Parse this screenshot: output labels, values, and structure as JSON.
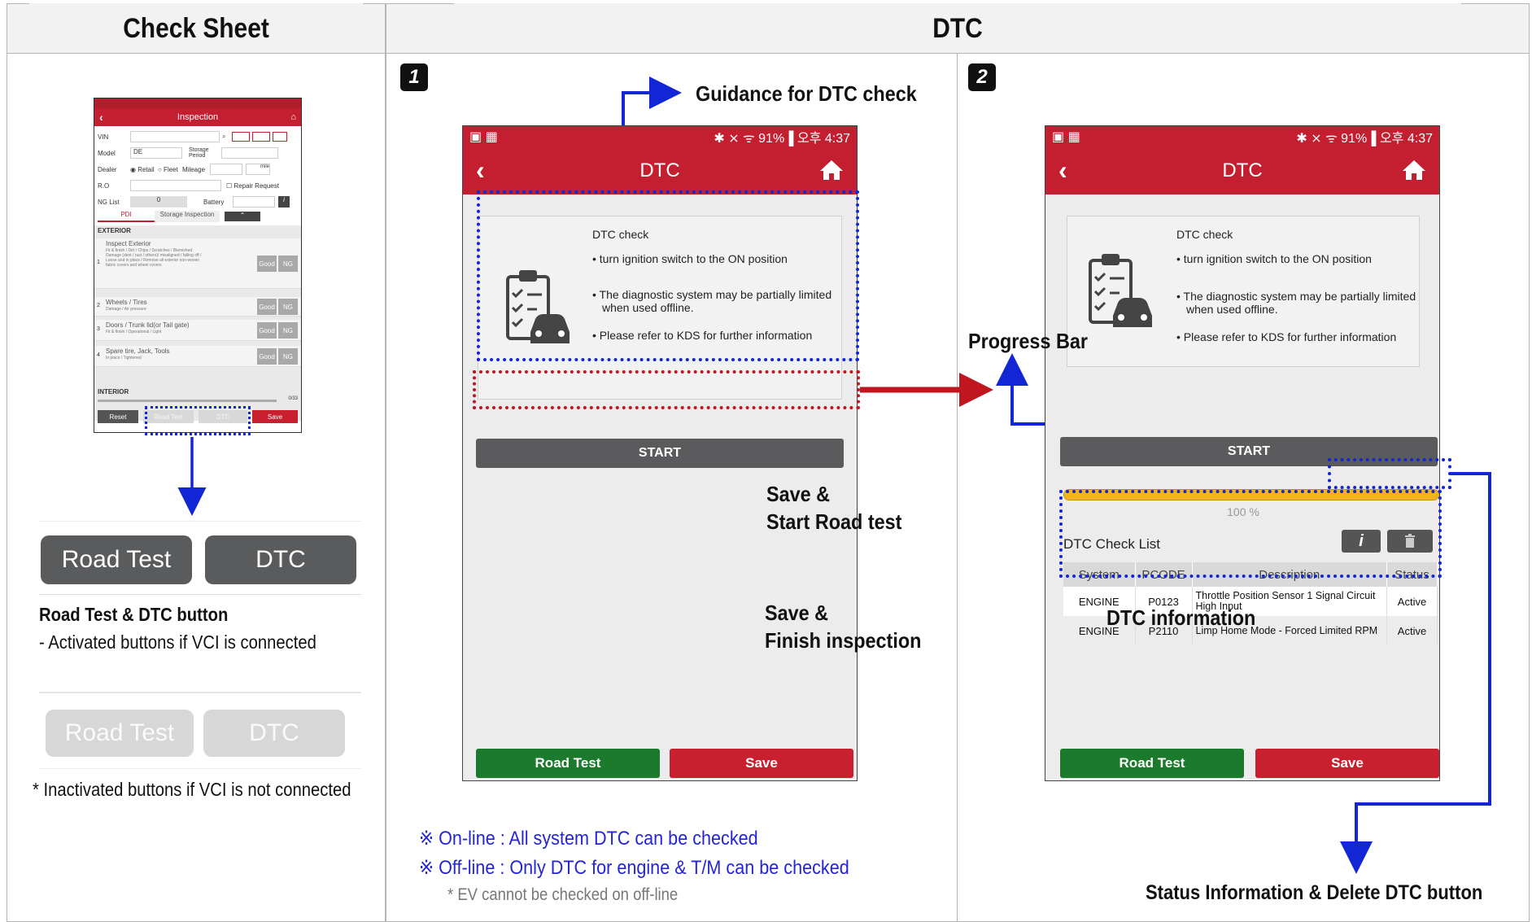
{
  "headers": {
    "check_sheet": "Check Sheet",
    "dtc": "DTC"
  },
  "steps": {
    "one": "1",
    "two": "2"
  },
  "phone": {
    "status_right": "✱ ⨯ ᯤ 91%▐ 오후 4:37",
    "title": "DTC",
    "dtc_check_title": "DTC check",
    "bullets": [
      "turn ignition switch to the ON position",
      "The diagnostic system may be partially limited when used offline.",
      "Please refer to KDS for further information"
    ],
    "start": "START",
    "road_test": "Road Test",
    "save": "Save",
    "progress_label": "100 %",
    "progress_value": 1.0,
    "check_list_title": "DTC Check List",
    "table_headers": [
      "System",
      "PCODE",
      "Description",
      "Status"
    ],
    "table_rows": [
      [
        "ENGINE",
        "P0123",
        "Throttle Position Sensor 1 Signal Circuit High Input",
        "Active"
      ],
      [
        "ENGINE",
        "P2110",
        "Limp Home Mode - Forced Limited RPM",
        "Active"
      ]
    ]
  },
  "callouts": {
    "guidance": "Guidance for DTC check",
    "save_road_1": "Save &",
    "save_road_2": "Start Road test",
    "save_finish_1": "Save &",
    "save_finish_2": "Finish inspection",
    "progress_bar": "Progress Bar",
    "dtc_information": "DTC information",
    "status_info": "Status Information & Delete DTC button"
  },
  "notes": {
    "online": "※ On-line : All system DTC can be checked",
    "offline": "※ Off-line : Only DTC  for engine & T/M can be checked",
    "ev": "* EV cannot be checked on off-line"
  },
  "check_sheet": {
    "active_road_test": "Road Test",
    "active_dtc": "DTC",
    "buttons_title": "Road Test & DTC button",
    "buttons_desc": "- Activated buttons if VCI is connected",
    "inactive_road_test": "Road Test",
    "inactive_dtc": "DTC",
    "inactive_note": "* Inactivated buttons if  VCI is not connected",
    "mini": {
      "title": "Inspection",
      "vin": "VIN",
      "model": "Model",
      "model_val": "DE",
      "storage": "Storage Period",
      "dealer": "Dealer",
      "retail": "◉ Retail",
      "fleet": "○ Fleet",
      "mileage": "Mileage",
      "unit": "mile",
      "ro": "R.O",
      "repair": "☐ Repair Request",
      "ng_list": "NG List",
      "ng_val": "0",
      "battery": "Battery",
      "tab_pdi": "PDI",
      "tab_storage": "Storage Inspection",
      "exterior": "EXTERIOR",
      "items": [
        {
          "n": "1",
          "title": "Inspect Exterior",
          "sub": "Fit & finish / Dirt / Chips / Scratches / Blemished Damage (dent / rust / others)/ misaligned / falling off / Loose and in place / Remove all exterior non-woven fabric covers and wheel covers"
        },
        {
          "n": "2",
          "title": "Wheels / Tires",
          "sub": "Damage / Air pressure"
        },
        {
          "n": "3",
          "title": "Doors / Trunk lid(or Tail gate)",
          "sub": "Fit & finish / Operational / Light"
        },
        {
          "n": "4",
          "title": "Spare tire, Jack, Tools",
          "sub": "In place / Tightened"
        }
      ],
      "good": "Good",
      "ng": "NG",
      "interior": "INTERIOR",
      "count": "0/33",
      "reset": "Reset",
      "road_test": "Road Test",
      "dtc": "DTC",
      "save": "Save"
    }
  },
  "colors": {
    "brand_red": "#c31f30",
    "green": "#1b7a2b",
    "blue": "#1226d6",
    "arrow_red": "#c0161f",
    "progress": "#f2b41c"
  }
}
